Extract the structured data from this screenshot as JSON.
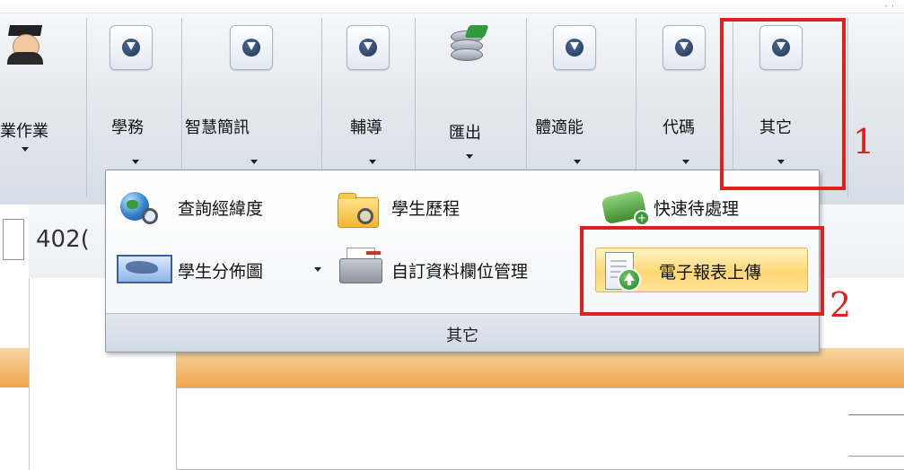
{
  "ribbon": {
    "buttons": [
      {
        "label": "業作業",
        "icon": "graduate-icon"
      },
      {
        "label": "學務",
        "icon": "arrow-down-circle-icon"
      },
      {
        "label": "智慧簡訊",
        "icon": "arrow-down-circle-icon"
      },
      {
        "label": "輔導",
        "icon": "arrow-down-circle-icon"
      },
      {
        "label": "匯出",
        "icon": "database-export-icon"
      },
      {
        "label": "體適能",
        "icon": "arrow-down-circle-icon"
      },
      {
        "label": "代碼",
        "icon": "arrow-down-circle-icon"
      },
      {
        "label": "其它",
        "icon": "arrow-down-circle-icon"
      }
    ]
  },
  "background": {
    "tab_text": "402("
  },
  "menu": {
    "items": [
      {
        "label": "查詢經緯度",
        "icon": "globe-search-icon"
      },
      {
        "label": "學生歷程",
        "icon": "folder-search-icon"
      },
      {
        "label": "快速待處理",
        "icon": "money-add-icon"
      },
      {
        "label": "學生分佈圖",
        "icon": "map-icon",
        "has_dropdown": true
      },
      {
        "label": "自訂資料欄位管理",
        "icon": "printer-icon"
      },
      {
        "label": "電子報表上傳",
        "icon": "document-upload-icon",
        "highlighted": true
      }
    ],
    "group_label": "其它"
  },
  "annotations": {
    "step1": "1",
    "step2": "2",
    "color": "#e0201b"
  },
  "colors": {
    "ribbon_bg": "#e3e8ee",
    "highlight": "#ffd874",
    "orange_bar": "#f0a64c"
  }
}
